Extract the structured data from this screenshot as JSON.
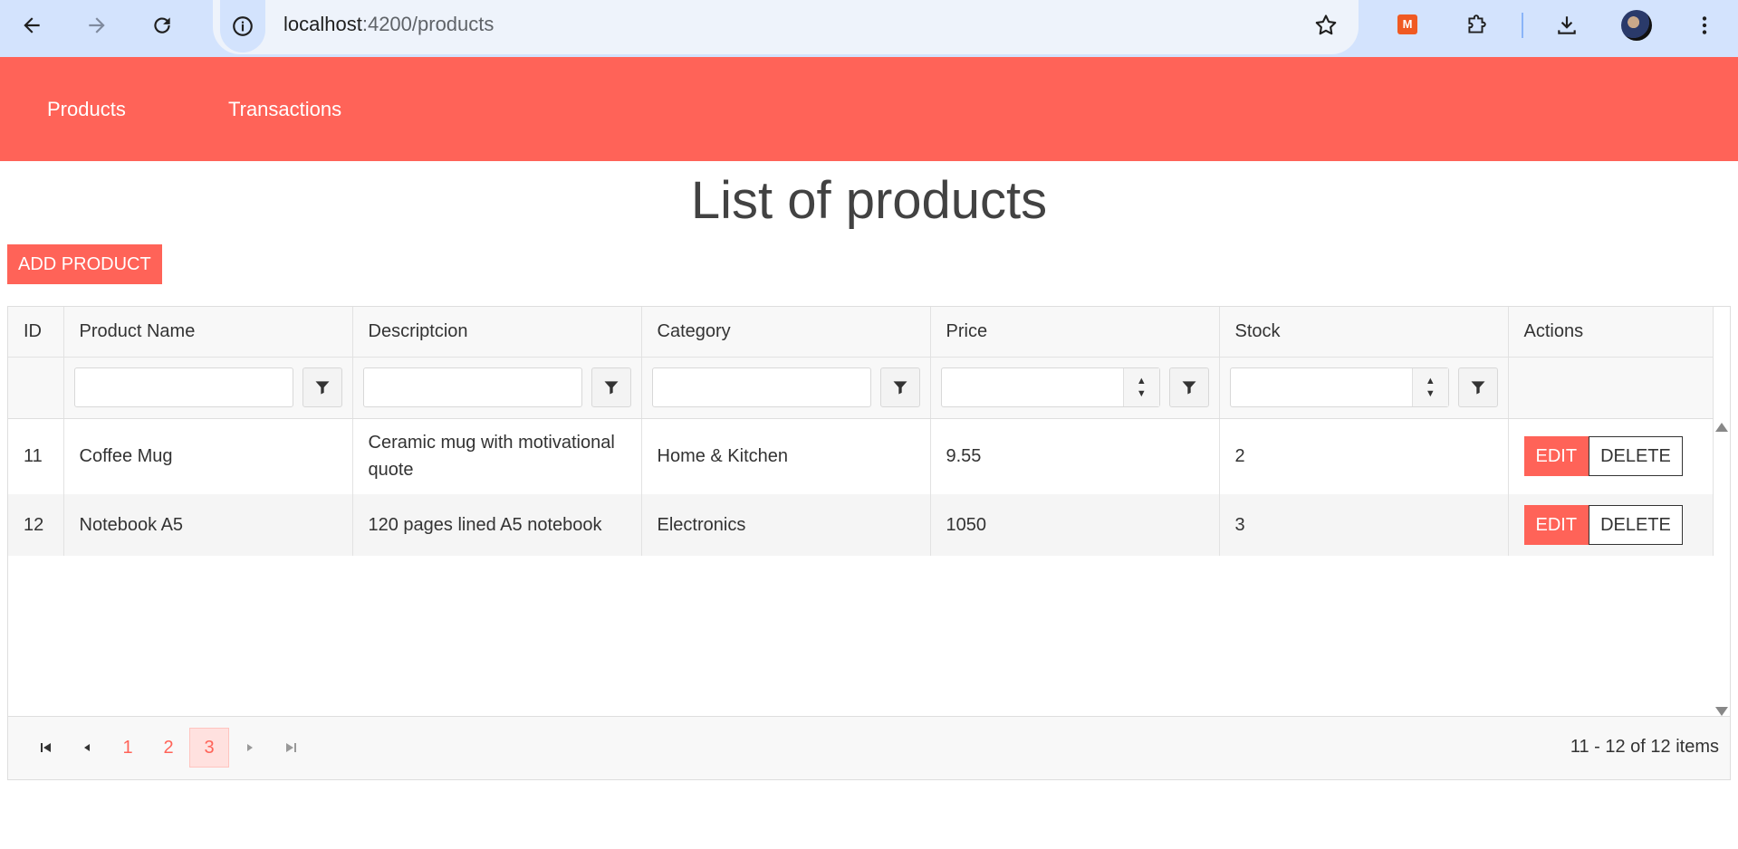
{
  "browser": {
    "url_host": "localhost",
    "url_path": ":4200/products",
    "extension_badge": "M"
  },
  "nav": {
    "items": [
      {
        "label": "Products"
      },
      {
        "label": "Transactions"
      }
    ]
  },
  "page": {
    "title": "List of products",
    "add_button": "ADD PRODUCT"
  },
  "grid": {
    "columns": [
      "ID",
      "Product Name",
      "Descriptcion",
      "Category",
      "Price",
      "Stock",
      "Actions"
    ],
    "rows": [
      {
        "id": "11",
        "name": "Coffee Mug",
        "description": "Ceramic mug with motivational quote",
        "category": "Home & Kitchen",
        "price": "9.55",
        "stock": "2"
      },
      {
        "id": "12",
        "name": "Notebook A5",
        "description": "120 pages lined A5 notebook",
        "category": "Electronics",
        "price": "1050",
        "stock": "3"
      }
    ],
    "edit_label": "EDIT",
    "delete_label": "DELETE",
    "pager": {
      "pages": [
        "1",
        "2",
        "3"
      ],
      "current_page": "3",
      "info": "11 - 12 of 12 items"
    }
  },
  "colors": {
    "accent": "#ff6358",
    "browser_bar": "#d3e3fd"
  }
}
